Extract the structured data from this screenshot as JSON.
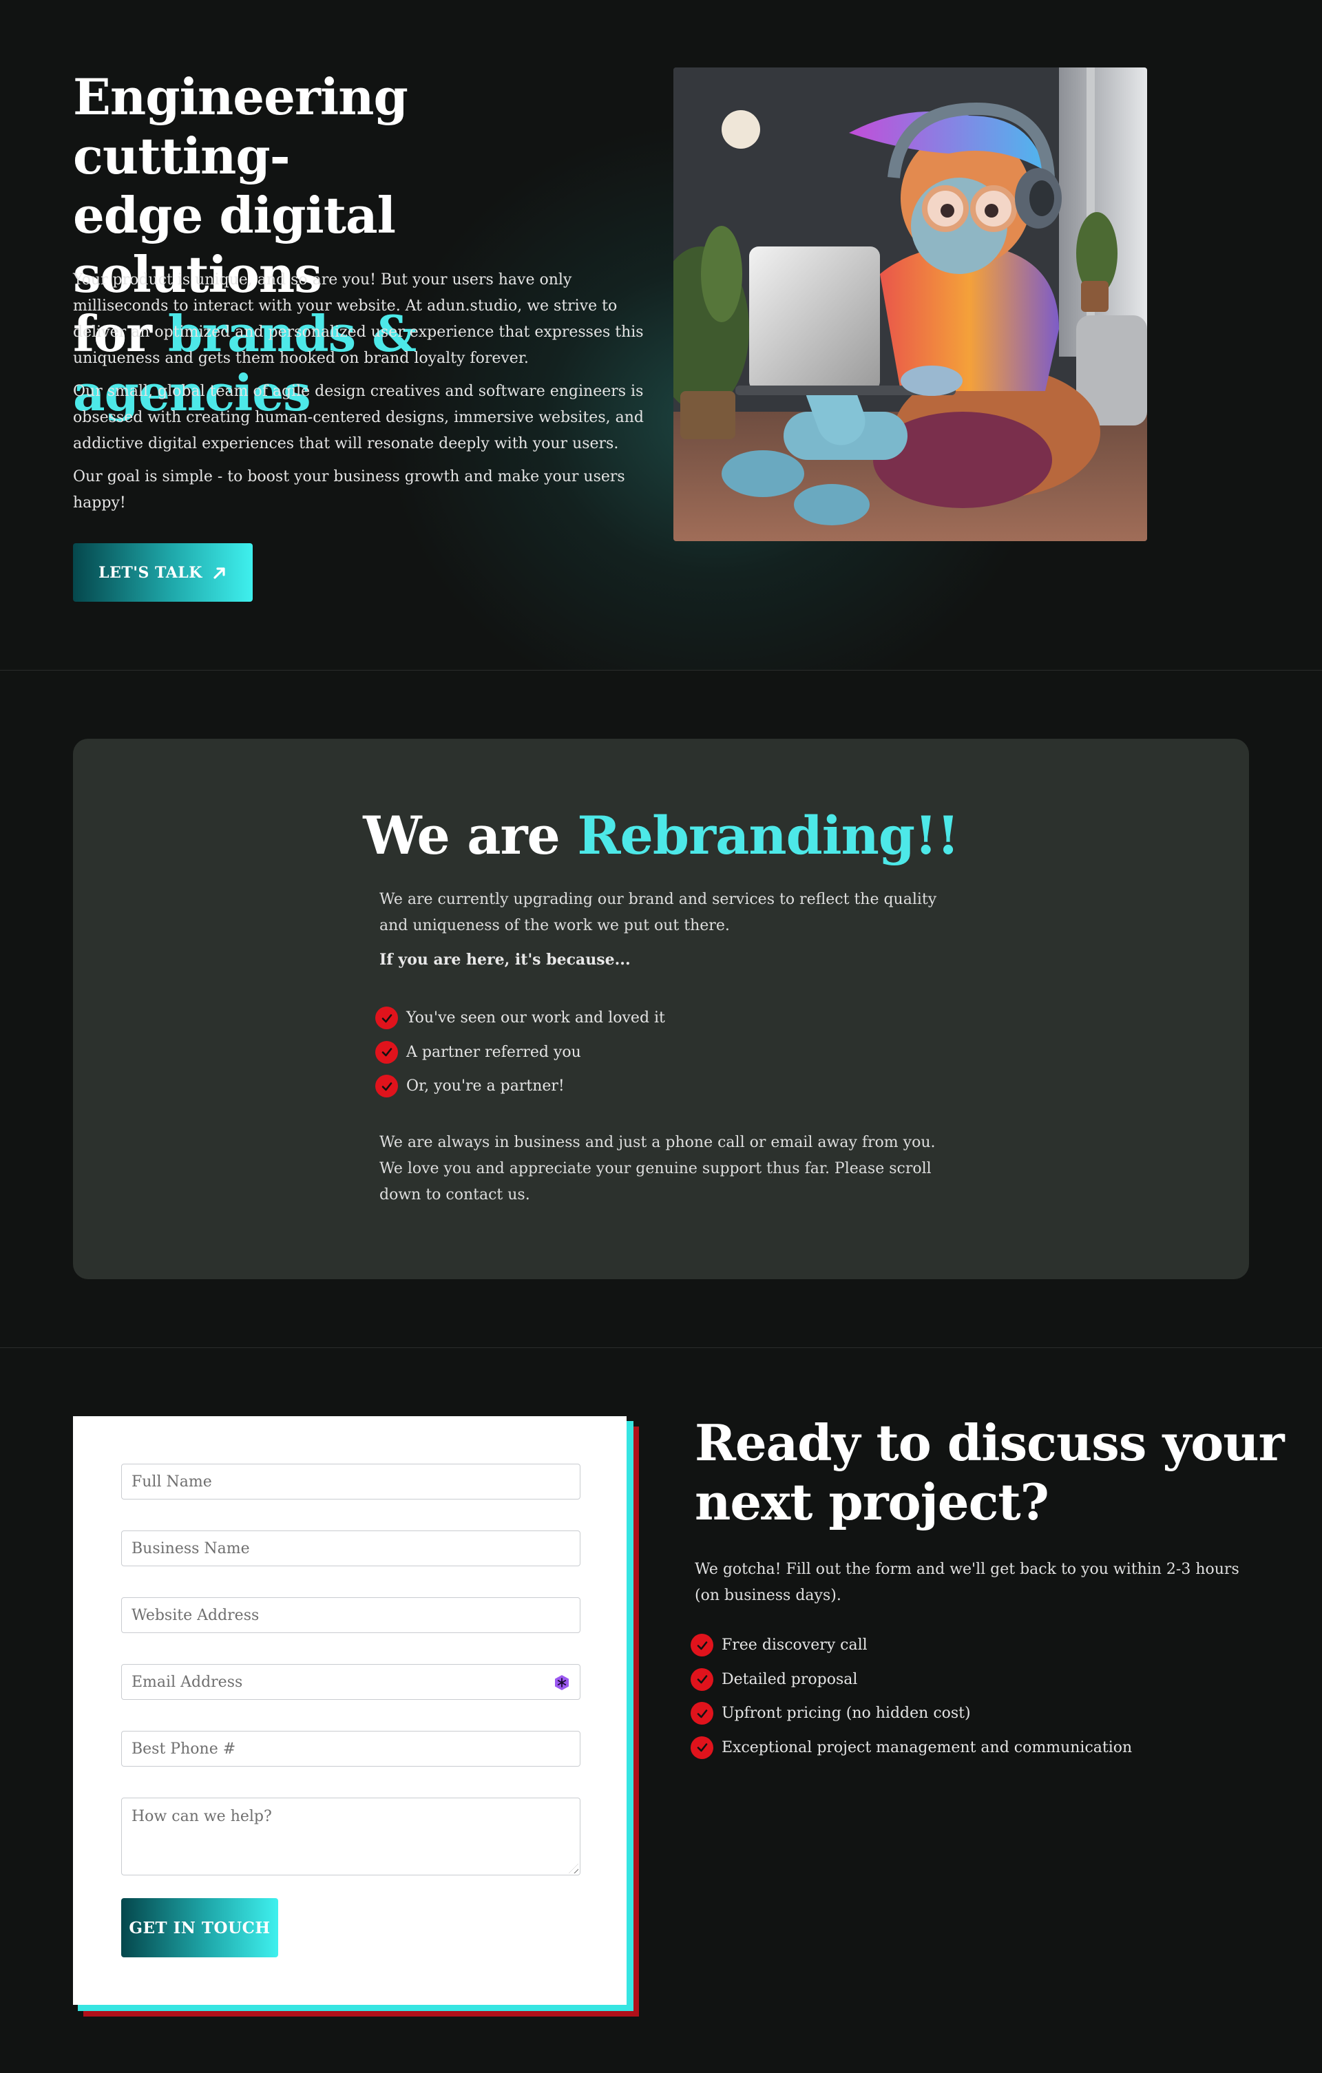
{
  "hero": {
    "title_line1": "Engineering cutting-",
    "title_line2": "edge digital solutions",
    "title_line3_plain": "for ",
    "title_line3_accent": "brands & agencies",
    "paragraphs": [
      "Your product is unique, and so are you! But your users have only milliseconds to interact with your website. At adun.studio, we strive to deliver an optimized and personalized user experience that expresses this uniqueness and gets them hooked on brand loyalty forever.",
      "Our small, global team of agile design creatives and software engineers is obsessed with creating human-centered designs, immersive websites, and addictive digital experiences that will resonate deeply with your users.",
      "Our goal is simple - to boost your business growth and make your users happy!"
    ],
    "cta_label": "LET'S TALK",
    "cta_icon": "arrow-up-right-icon",
    "image": "3d-character-with-headphones-using-laptop"
  },
  "rebrand": {
    "title_plain": "We are ",
    "title_accent": "Rebranding!!",
    "intro": "We are currently upgrading our brand and services to reflect the quality and uniqueness of the work we put out there.",
    "lead": "If you are here, it's because...",
    "reasons": [
      "You've seen our work and loved it",
      "A partner referred you",
      "Or, you're a partner!"
    ],
    "closing": "We are always in business and just a phone call or email away from you. We love you and appreciate your genuine support thus far. Please scroll down to contact us."
  },
  "contact_form": {
    "fields": {
      "full_name": "Full Name",
      "business_name": "Business Name",
      "website": "Website Address",
      "email": "Email Address",
      "phone": "Best Phone #",
      "message": "How can we help?"
    },
    "submit_label": "GET IN TOUCH"
  },
  "contact": {
    "title": "Ready to discuss your next project?",
    "text": "We gotcha! Fill out the form and we'll get back to you within 2-3 hours (on business days).",
    "benefits": [
      "Free discovery call",
      "Detailed proposal",
      "Upfront pricing (no hidden cost)",
      "Exceptional project management and communication"
    ]
  },
  "colors": {
    "background": "#111312",
    "accent_cyan": "#4de8e8",
    "card_bg": "#2c312d",
    "check_red": "#e0131c",
    "shadow_red": "#b0101a"
  }
}
